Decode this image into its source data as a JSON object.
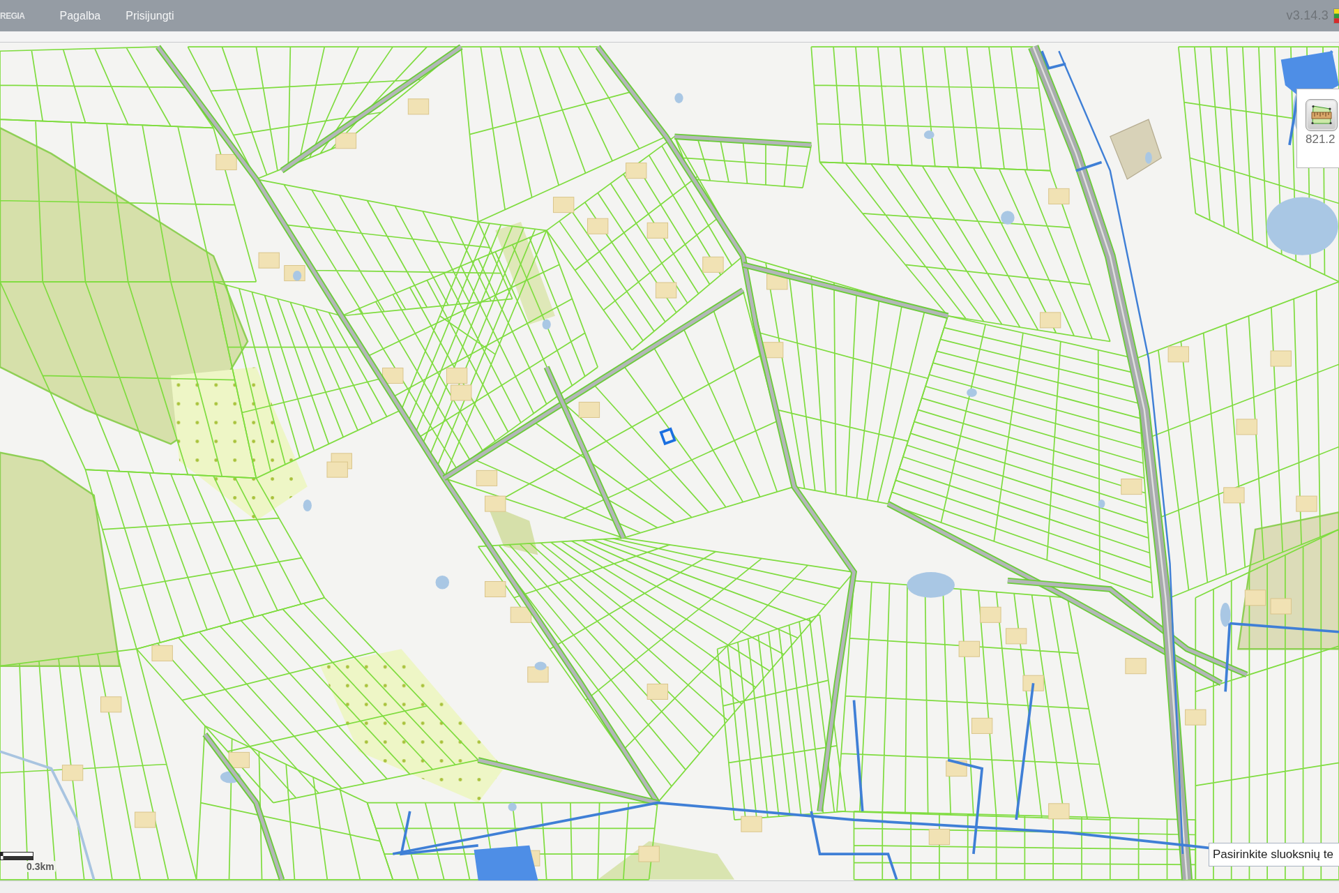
{
  "top_bar": {
    "brand": "REGIA",
    "menu": [
      {
        "label": "Pagalba"
      },
      {
        "label": "Prisijungti"
      }
    ],
    "version": "v3.14.3"
  },
  "measure_panel": {
    "reading": "821.2"
  },
  "scale_bar": {
    "label": "0.3km"
  },
  "layer_select": {
    "placeholder": "Pasirinkite sluoksnių te"
  }
}
